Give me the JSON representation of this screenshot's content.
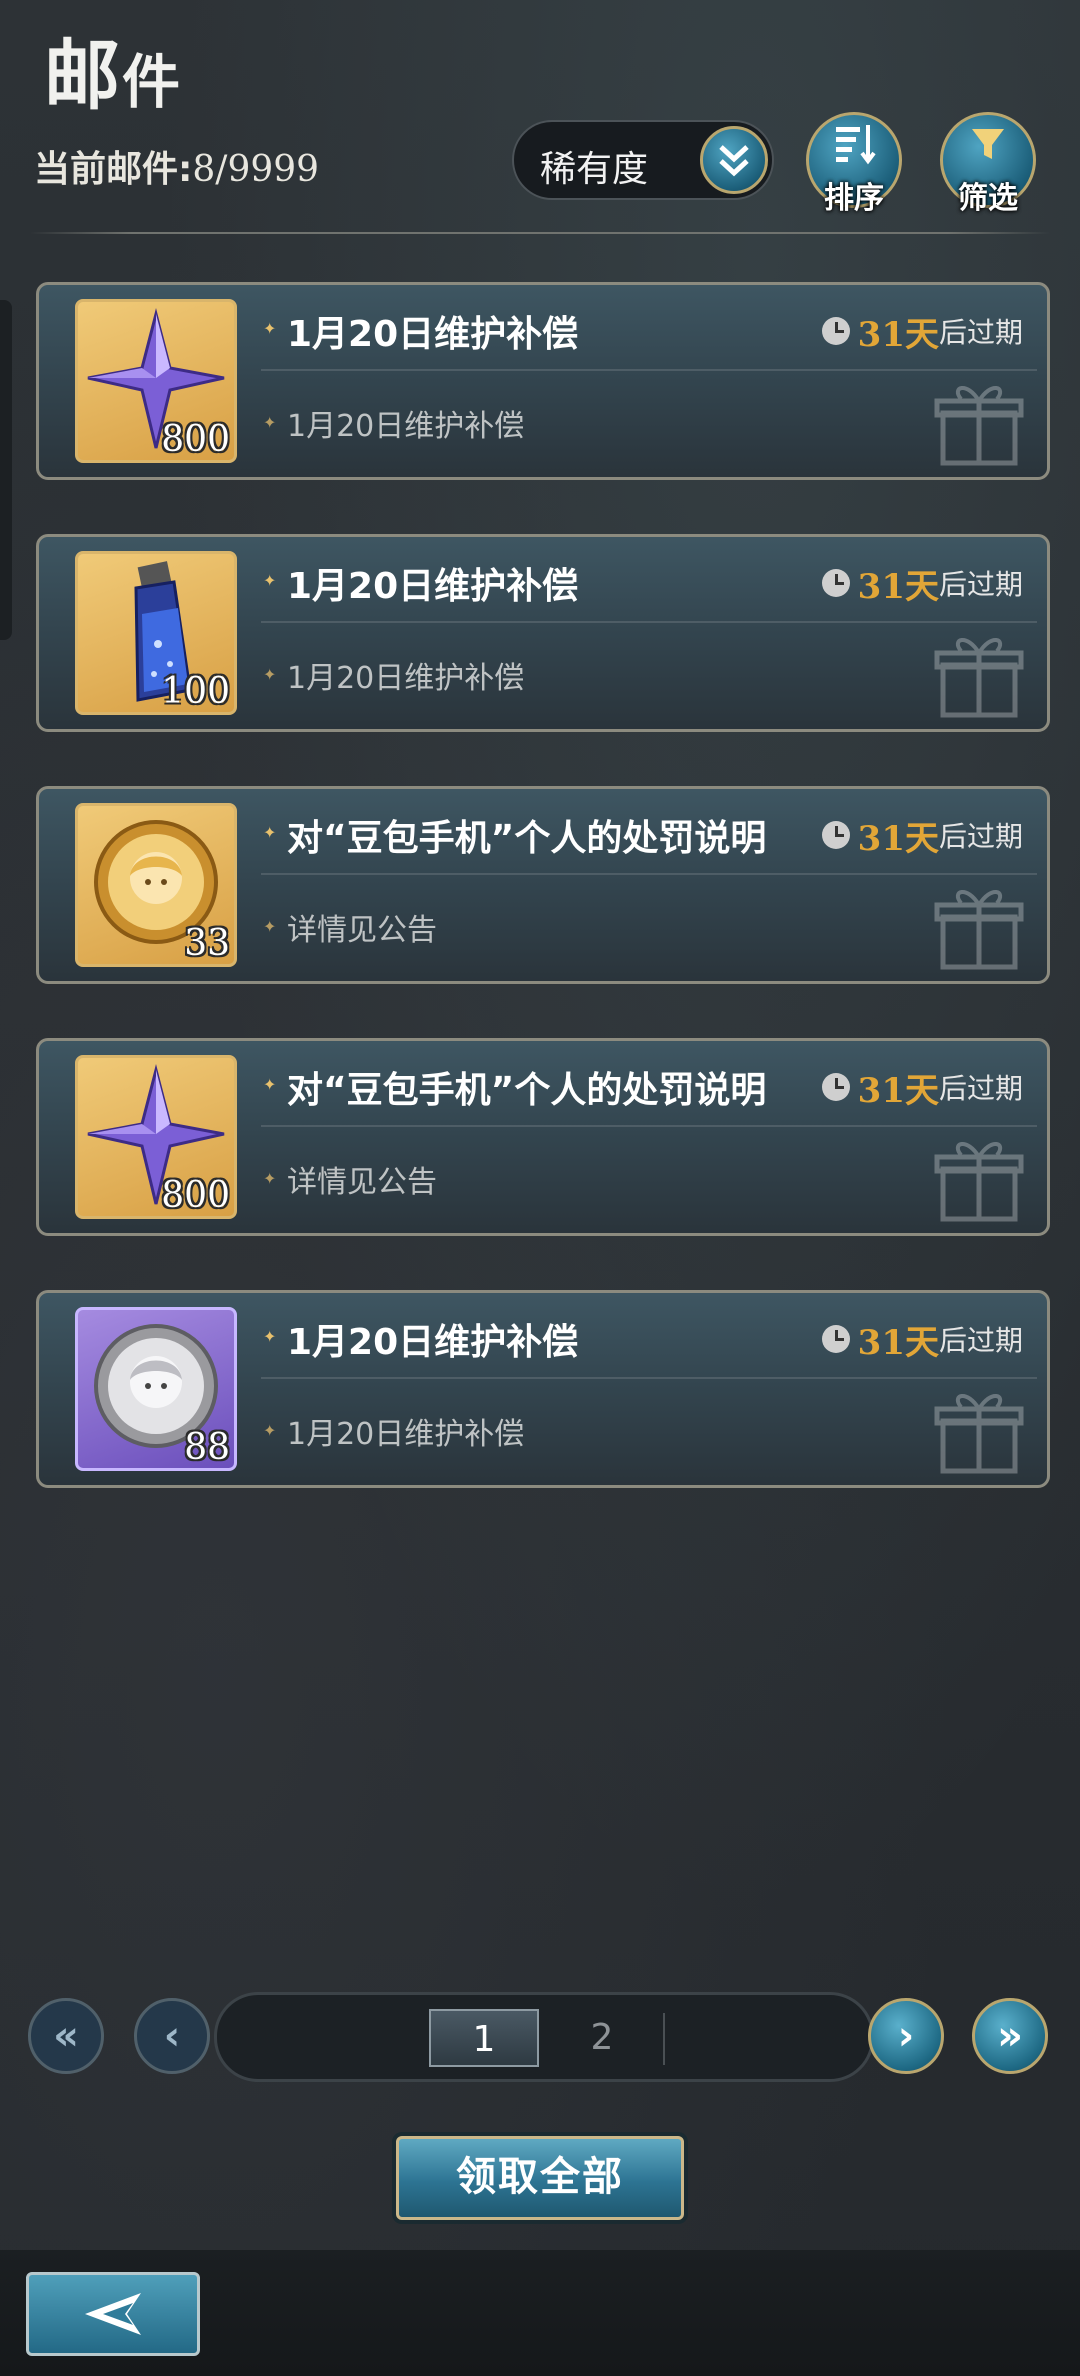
{
  "header": {
    "title_big": "邮",
    "title_small": "件",
    "count_label": "当前邮件:",
    "count_value": "8/9999"
  },
  "toolbar": {
    "sort_dropdown_value": "稀有度",
    "sort_button_label": "排序",
    "filter_button_label": "筛选"
  },
  "mails": [
    {
      "subject": "1月20日维护补偿",
      "desc": "1月20日维护补偿",
      "quantity": "800",
      "item_icon": "crystal-star-icon",
      "days": "31天",
      "expire_suffix": "后过期"
    },
    {
      "subject": "1月20日维护补偿",
      "desc": "1月20日维护补偿",
      "quantity": "100",
      "item_icon": "potion-bottle-icon",
      "days": "31天",
      "expire_suffix": "后过期"
    },
    {
      "subject": "对“豆包手机”个人的处罚说明",
      "desc": "详情见公告",
      "quantity": "33",
      "item_icon": "gold-coin-icon",
      "days": "31天",
      "expire_suffix": "后过期"
    },
    {
      "subject": "对“豆包手机”个人的处罚说明",
      "desc": "详情见公告",
      "quantity": "800",
      "item_icon": "crystal-star-icon",
      "days": "31天",
      "expire_suffix": "后过期"
    },
    {
      "subject": "1月20日维护补偿",
      "desc": "1月20日维护补偿",
      "quantity": "88",
      "item_icon": "silver-coin-icon",
      "days": "31天",
      "expire_suffix": "后过期"
    }
  ],
  "pagination": {
    "current_page": "1",
    "other_page": "2"
  },
  "actions": {
    "claim_all_label": "领取全部"
  },
  "colors": {
    "accent_gold": "#e2a637",
    "button_blue": "#2d7493",
    "card_border": "#8c8b7f"
  }
}
